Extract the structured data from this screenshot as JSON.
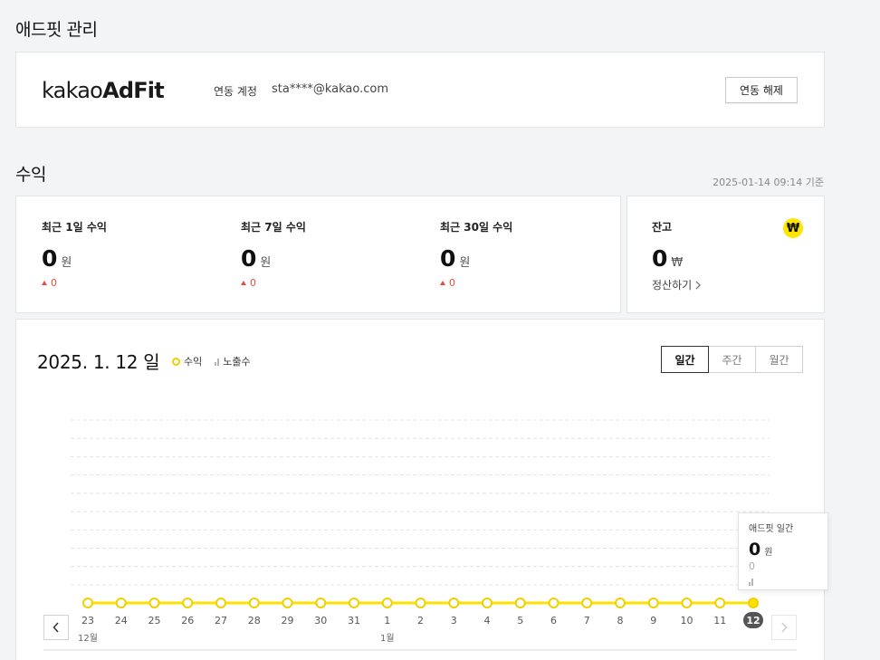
{
  "page": {
    "title": "애드핏 관리"
  },
  "account": {
    "logo_light": "kakao",
    "logo_bold": "AdFit",
    "label": "연동 계정",
    "email": "sta****@kakao.com",
    "unlink_button": "연동 해제"
  },
  "revenue": {
    "section_title": "수익",
    "timestamp": "2025-01-14 09:14 기준",
    "stats": [
      {
        "label": "최근 1일 수익",
        "value": "0",
        "unit": "원",
        "delta": "0"
      },
      {
        "label": "최근 7일 수익",
        "value": "0",
        "unit": "원",
        "delta": "0"
      },
      {
        "label": "최근 30일 수익",
        "value": "0",
        "unit": "원",
        "delta": "0"
      }
    ],
    "balance": {
      "label": "잔고",
      "value": "0",
      "unit": "₩",
      "icon_text": "₩",
      "settle_link": "정산하기"
    }
  },
  "chart": {
    "date_title": "2025. 1. 12 일",
    "legend": {
      "revenue": "수익",
      "impressions": "노출수"
    },
    "tabs": [
      "일간",
      "주간",
      "월간"
    ],
    "active_tab": "일간",
    "tooltip": {
      "title": "애드핏 일간",
      "value": "0",
      "unit": "원",
      "impressions": "0"
    },
    "colors": {
      "line": "#ffe100",
      "point_stroke": "#f2cf00",
      "selected_badge": "#555555"
    }
  },
  "chart_data": {
    "type": "line",
    "x": [
      "23",
      "24",
      "25",
      "26",
      "27",
      "28",
      "29",
      "30",
      "31",
      "1",
      "2",
      "3",
      "4",
      "5",
      "6",
      "7",
      "8",
      "9",
      "10",
      "11",
      "12"
    ],
    "month_labels": [
      {
        "at": "23",
        "label": "12월"
      },
      {
        "at": "1",
        "label": "1월"
      }
    ],
    "series": [
      {
        "name": "수익",
        "values": [
          0,
          0,
          0,
          0,
          0,
          0,
          0,
          0,
          0,
          0,
          0,
          0,
          0,
          0,
          0,
          0,
          0,
          0,
          0,
          0,
          0
        ]
      }
    ],
    "selected": "12",
    "grid": true
  }
}
